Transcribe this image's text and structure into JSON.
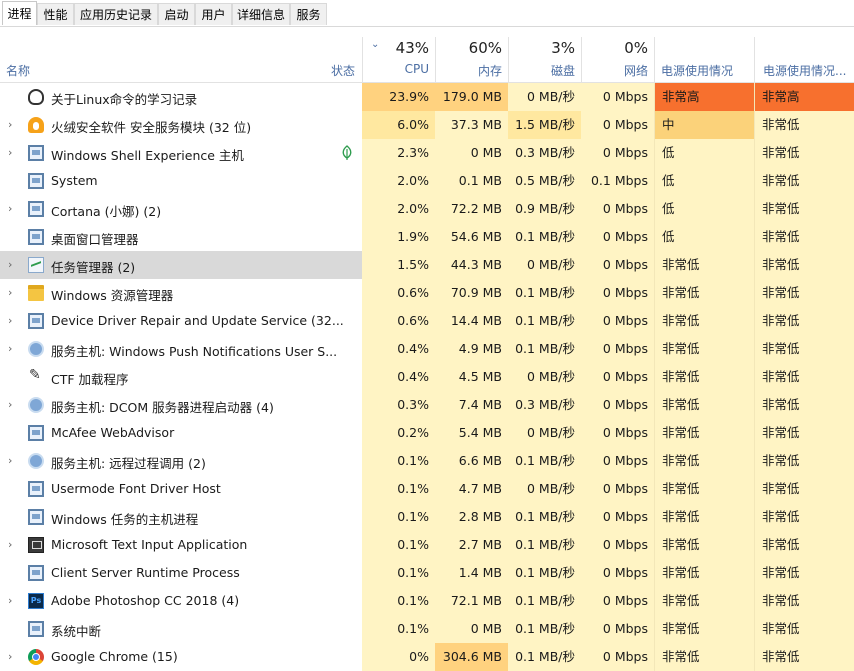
{
  "tabs": [
    "进程",
    "性能",
    "应用历史记录",
    "启动",
    "用户",
    "详细信息",
    "服务"
  ],
  "header": {
    "name_label": "名称",
    "status_label": "状态",
    "cpu": {
      "pct": "43%",
      "label": "CPU"
    },
    "mem": {
      "pct": "60%",
      "label": "内存"
    },
    "disk": {
      "pct": "3%",
      "label": "磁盘"
    },
    "net": {
      "pct": "0%",
      "label": "网络"
    },
    "power_label": "电源使用情况",
    "power_trend_label": "电源使用情况..."
  },
  "colors": {
    "heat_low": "#fff4c4",
    "heat_mid": "#ffe8a0",
    "heat_high": "#ffd27f",
    "power_very_high": "#f7702e",
    "power_medium": "#fbd27a",
    "selected_row": "#d9d9d9"
  },
  "processes": [
    {
      "name": "关于Linux命令的学习记录",
      "icon": "tux-icon",
      "expand": false,
      "status_icon": "",
      "cpu": "23.9%",
      "mem": "179.0 MB",
      "disk": "0 MB/秒",
      "net": "0 Mbps",
      "power": "非常高",
      "power_trend": "非常高"
    },
    {
      "name": "火绒安全软件 安全服务模块 (32 位)",
      "icon": "fire-shield-icon",
      "expand": true,
      "status_icon": "",
      "cpu": "6.0%",
      "mem": "37.3 MB",
      "disk": "1.5 MB/秒",
      "net": "0 Mbps",
      "power": "中",
      "power_trend": "非常低"
    },
    {
      "name": "Windows Shell Experience 主机",
      "icon": "window-icon",
      "expand": true,
      "status_icon": "leaf-icon",
      "cpu": "2.3%",
      "mem": "0 MB",
      "disk": "0.3 MB/秒",
      "net": "0 Mbps",
      "power": "低",
      "power_trend": "非常低"
    },
    {
      "name": "System",
      "icon": "window-icon",
      "expand": false,
      "status_icon": "",
      "cpu": "2.0%",
      "mem": "0.1 MB",
      "disk": "0.5 MB/秒",
      "net": "0.1 Mbps",
      "power": "低",
      "power_trend": "非常低"
    },
    {
      "name": "Cortana (小娜) (2)",
      "icon": "window-icon",
      "expand": true,
      "status_icon": "",
      "cpu": "2.0%",
      "mem": "72.2 MB",
      "disk": "0.9 MB/秒",
      "net": "0 Mbps",
      "power": "低",
      "power_trend": "非常低"
    },
    {
      "name": "桌面窗口管理器",
      "icon": "window-icon",
      "expand": false,
      "status_icon": "",
      "cpu": "1.9%",
      "mem": "54.6 MB",
      "disk": "0.1 MB/秒",
      "net": "0 Mbps",
      "power": "低",
      "power_trend": "非常低"
    },
    {
      "name": "任务管理器 (2)",
      "icon": "task-manager-icon",
      "expand": true,
      "status_icon": "",
      "cpu": "1.5%",
      "mem": "44.3 MB",
      "disk": "0 MB/秒",
      "net": "0 Mbps",
      "power": "非常低",
      "power_trend": "非常低",
      "selected": true
    },
    {
      "name": "Windows 资源管理器",
      "icon": "folder-icon",
      "expand": true,
      "status_icon": "",
      "cpu": "0.6%",
      "mem": "70.9 MB",
      "disk": "0.1 MB/秒",
      "net": "0 Mbps",
      "power": "非常低",
      "power_trend": "非常低"
    },
    {
      "name": "Device Driver Repair and Update Service (32...",
      "icon": "window-icon",
      "expand": true,
      "status_icon": "",
      "cpu": "0.6%",
      "mem": "14.4 MB",
      "disk": "0.1 MB/秒",
      "net": "0 Mbps",
      "power": "非常低",
      "power_trend": "非常低"
    },
    {
      "name": "服务主机: Windows Push Notifications User S...",
      "icon": "gear-icon",
      "expand": true,
      "status_icon": "",
      "cpu": "0.4%",
      "mem": "4.9 MB",
      "disk": "0.1 MB/秒",
      "net": "0 Mbps",
      "power": "非常低",
      "power_trend": "非常低"
    },
    {
      "name": "CTF 加载程序",
      "icon": "pen-icon",
      "expand": false,
      "status_icon": "",
      "cpu": "0.4%",
      "mem": "4.5 MB",
      "disk": "0 MB/秒",
      "net": "0 Mbps",
      "power": "非常低",
      "power_trend": "非常低"
    },
    {
      "name": "服务主机: DCOM 服务器进程启动器 (4)",
      "icon": "gear-icon",
      "expand": true,
      "status_icon": "",
      "cpu": "0.3%",
      "mem": "7.4 MB",
      "disk": "0.3 MB/秒",
      "net": "0 Mbps",
      "power": "非常低",
      "power_trend": "非常低"
    },
    {
      "name": "McAfee WebAdvisor",
      "icon": "window-icon",
      "expand": false,
      "status_icon": "",
      "cpu": "0.2%",
      "mem": "5.4 MB",
      "disk": "0 MB/秒",
      "net": "0 Mbps",
      "power": "非常低",
      "power_trend": "非常低"
    },
    {
      "name": "服务主机: 远程过程调用 (2)",
      "icon": "gear-icon",
      "expand": true,
      "status_icon": "",
      "cpu": "0.1%",
      "mem": "6.6 MB",
      "disk": "0.1 MB/秒",
      "net": "0 Mbps",
      "power": "非常低",
      "power_trend": "非常低"
    },
    {
      "name": "Usermode Font Driver Host",
      "icon": "window-icon",
      "expand": false,
      "status_icon": "",
      "cpu": "0.1%",
      "mem": "4.7 MB",
      "disk": "0 MB/秒",
      "net": "0 Mbps",
      "power": "非常低",
      "power_trend": "非常低"
    },
    {
      "name": "Windows 任务的主机进程",
      "icon": "window-icon",
      "expand": false,
      "status_icon": "",
      "cpu": "0.1%",
      "mem": "2.8 MB",
      "disk": "0.1 MB/秒",
      "net": "0 Mbps",
      "power": "非常低",
      "power_trend": "非常低"
    },
    {
      "name": "Microsoft Text Input Application",
      "icon": "keyboard-icon",
      "expand": true,
      "status_icon": "",
      "cpu": "0.1%",
      "mem": "2.7 MB",
      "disk": "0.1 MB/秒",
      "net": "0 Mbps",
      "power": "非常低",
      "power_trend": "非常低"
    },
    {
      "name": "Client Server Runtime Process",
      "icon": "window-icon",
      "expand": false,
      "status_icon": "",
      "cpu": "0.1%",
      "mem": "1.4 MB",
      "disk": "0.1 MB/秒",
      "net": "0 Mbps",
      "power": "非常低",
      "power_trend": "非常低"
    },
    {
      "name": "Adobe Photoshop CC 2018 (4)",
      "icon": "photoshop-icon",
      "expand": true,
      "status_icon": "",
      "cpu": "0.1%",
      "mem": "72.1 MB",
      "disk": "0.1 MB/秒",
      "net": "0 Mbps",
      "power": "非常低",
      "power_trend": "非常低"
    },
    {
      "name": "系统中断",
      "icon": "window-icon",
      "expand": false,
      "status_icon": "",
      "cpu": "0.1%",
      "mem": "0 MB",
      "disk": "0.1 MB/秒",
      "net": "0 Mbps",
      "power": "非常低",
      "power_trend": "非常低"
    },
    {
      "name": "Google Chrome (15)",
      "icon": "chrome-icon",
      "expand": true,
      "status_icon": "",
      "cpu": "0%",
      "mem": "304.6 MB",
      "disk": "0.1 MB/秒",
      "net": "0 Mbps",
      "power": "非常低",
      "power_trend": "非常低"
    }
  ]
}
